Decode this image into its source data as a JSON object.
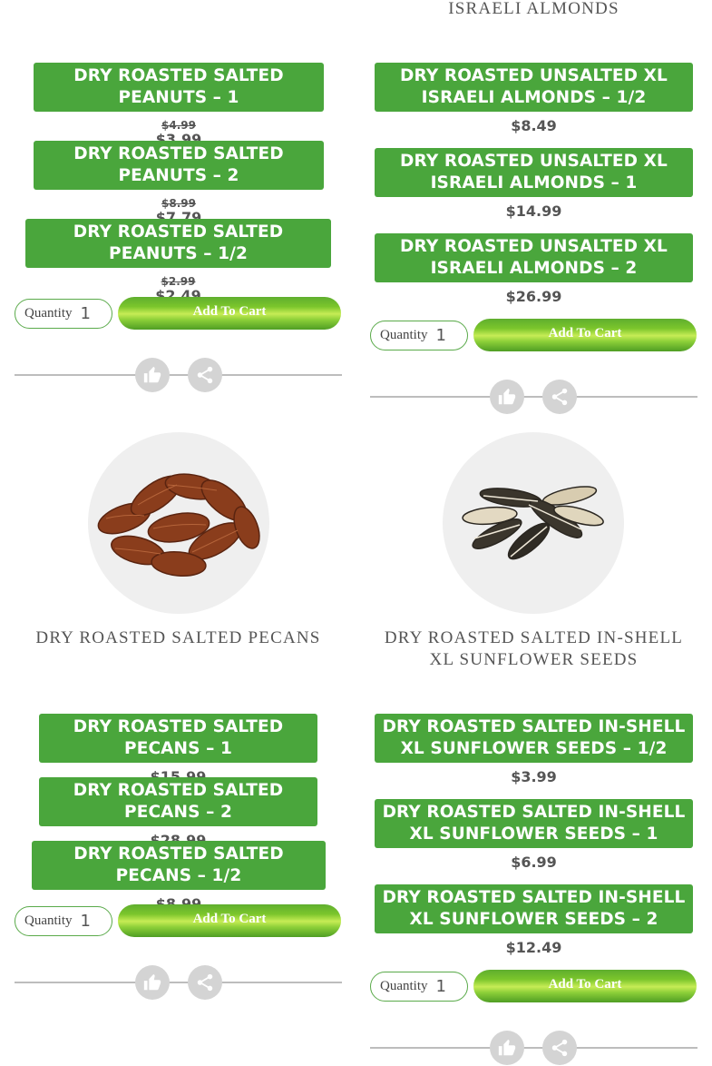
{
  "products": [
    {
      "title": "",
      "variants": [
        {
          "label": "DRY ROASTED SALTED PEANUTS – 1",
          "old_price": "$4.99",
          "price": "$3.99"
        },
        {
          "label": "DRY ROASTED SALTED PEANUTS – 2",
          "old_price": "$8.99",
          "price": "$7.79"
        },
        {
          "label": "DRY ROASTED SALTED PEANUTS – 1/2",
          "old_price": "$2.99",
          "price": "$2.49"
        }
      ]
    },
    {
      "title": "ISRAELI ALMONDS",
      "variants": [
        {
          "label": "DRY ROASTED UNSALTED XL ISRAELI ALMONDS – 1/2",
          "price": "$8.49"
        },
        {
          "label": "DRY ROASTED UNSALTED XL ISRAELI ALMONDS – 1",
          "price": "$14.99"
        },
        {
          "label": "DRY ROASTED UNSALTED XL ISRAELI ALMONDS – 2",
          "price": "$26.99"
        }
      ]
    },
    {
      "title": "DRY ROASTED SALTED PECANS",
      "image": "pecans-image",
      "variants": [
        {
          "label": "DRY ROASTED SALTED PECANS – 1",
          "price": "$15.99"
        },
        {
          "label": "DRY ROASTED SALTED PECANS – 2",
          "price": "$28.99"
        },
        {
          "label": "DRY ROASTED SALTED PECANS – 1/2",
          "price": "$8.99"
        }
      ]
    },
    {
      "title": "DRY ROASTED SALTED IN-SHELL XL SUNFLOWER SEEDS",
      "image": "sunflower-seeds-image",
      "variants": [
        {
          "label": "DRY ROASTED SALTED IN-SHELL XL SUNFLOWER SEEDS – 1/2",
          "price": "$3.99"
        },
        {
          "label": "DRY ROASTED SALTED IN-SHELL XL SUNFLOWER SEEDS – 1",
          "price": "$6.99"
        },
        {
          "label": "DRY ROASTED SALTED IN-SHELL XL SUNFLOWER SEEDS – 2",
          "price": "$12.49"
        }
      ]
    }
  ],
  "cart": {
    "quantity_label": "Quantity",
    "quantity_value": "1",
    "add_label": "Add To Cart"
  },
  "icons": {
    "like": "thumbs-up-icon",
    "share": "share-icon"
  },
  "colors": {
    "variant_green": "#4aa63c",
    "button_green": "#7cc62c",
    "icon_gray": "#d4d4d4"
  }
}
